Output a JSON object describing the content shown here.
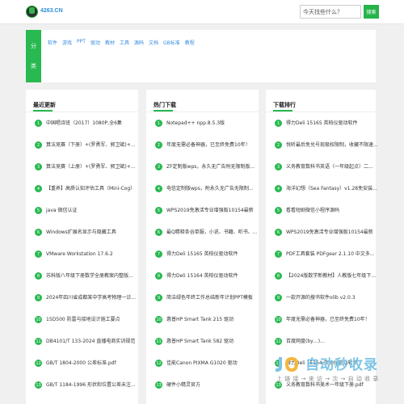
{
  "header": {
    "site_name": "4263.CN",
    "search_placeholder": "今天找些什么？",
    "search_button": "搜索"
  },
  "category": {
    "label_chars": [
      "分",
      "类"
    ],
    "items": [
      "软件",
      "游戏",
      "PPT",
      "驱动",
      "教材",
      "工具",
      "源码",
      "文档",
      "GB标准",
      "教程"
    ]
  },
  "panels": [
    {
      "title": "最近更新",
      "items": [
        "中国唱诗班（2017）1080P,全6集",
        "算法竞赛（下册）+(罗勇军、郭卫斌)+...",
        "算法竞赛（上册）+(罗勇军、郭卫斌)+...",
        "【重养】高质认知评估工具（Mini-Cog）",
        "java 微信认证",
        "Windows扩展名显示与隐藏工具",
        "VMware Workstation 17.6.2",
        "苏科版八年级下册数学全册教案内整版...",
        "2024年四川省成都某中学高考物理一诊...",
        "15D500 防雷与接地设计施工要点",
        "DB4101/T 133-2024 直播电商实训规范",
        "GB/T 1804-2000 公差标准.pdf",
        "GB/T 1184-1996 形状和位置公差未注..."
      ]
    },
    {
      "title": "热门下载",
      "items": [
        "Notepad++ npp.8.5.3版",
        "年度无需必备神器，已至终免费10年！",
        "ZF定制版wps，永久无广告附无限制版...",
        "电信定制版wps，附永久无广告无限制...",
        "WPS2019免激活专业增强版10154最新",
        "最Q精释条谷单服，小说、书籍、听书、...",
        "得力Deli 15165 英柏仪驱动软件",
        "得力Deli 15164 英柏仪驱动软件",
        "简洁绿色年终工作总结新年计划PPT模板",
        "惠普HP Smart Tank 215 驱动",
        "惠普HP Smart Tank 582 驱动",
        "佳能Canon PIXMA G1020 驱动",
        "硬件小精灵官方"
      ]
    },
    {
      "title": "下载排行",
      "items": [
        "得力Deli 15165 英柏仪驱动软件",
        "悦听最后免兑号现极权限制，收藏不限速...",
        "义务教育数科书英语（一年级起点）二...",
        "海洋幻想（Sea Fantasy）v1.28免安装...",
        "看看短剧微信小程序源码",
        "WPS2019免激活专业增强版10154最新",
        "PDF工具套装 PDFgear 2.1.10 中文多...",
        "【2024版数学新教材】人教版七年级下...",
        "一款开源的搜书软件olib v2.0.3",
        "年度无需必备神器，已至终免费10年！",
        "百度网盘(by…)…",
        "得力Deli 15164 英柏仪驱动软件",
        "义务教育数科书美术一年级下册.pdf"
      ]
    }
  ],
  "watermark": {
    "brand": "自动秒收录",
    "tagline": "上 链 接 → 来 访 → 次 → 自 动 收 录"
  }
}
